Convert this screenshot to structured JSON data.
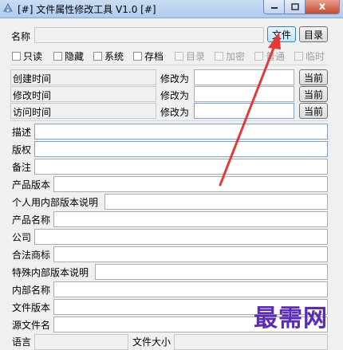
{
  "window": {
    "title": "[#] 文件属性修改工具 V1.0 [#]",
    "min_icon": "minimize-icon",
    "max_icon": "maximize-icon",
    "close_icon": "close-icon",
    "close_glyph": "x"
  },
  "name_row": {
    "label": "名称",
    "value": "",
    "file_button": "文件",
    "dir_button": "目录"
  },
  "attributes": [
    {
      "label": "只读",
      "checked": false,
      "enabled": true
    },
    {
      "label": "隐藏",
      "checked": false,
      "enabled": true
    },
    {
      "label": "系统",
      "checked": false,
      "enabled": true
    },
    {
      "label": "存档",
      "checked": false,
      "enabled": true
    },
    {
      "label": "目录",
      "checked": false,
      "enabled": false
    },
    {
      "label": "加密",
      "checked": false,
      "enabled": false
    },
    {
      "label": "普通",
      "checked": false,
      "enabled": false
    },
    {
      "label": "临时",
      "checked": false,
      "enabled": false
    }
  ],
  "times": [
    {
      "label": "创建时间",
      "modify_label": "修改为",
      "now_button": "当前"
    },
    {
      "label": "修改时间",
      "modify_label": "修改为",
      "now_button": "当前"
    },
    {
      "label": "访问时间",
      "modify_label": "修改为",
      "now_button": "当前"
    }
  ],
  "fields": [
    {
      "label": "描述"
    },
    {
      "label": "版权"
    },
    {
      "label": "备注"
    },
    {
      "label": "产品版本"
    },
    {
      "label": "个人用内部版本说明"
    },
    {
      "label": "产品名称"
    },
    {
      "label": "公司"
    },
    {
      "label": "合法商标"
    },
    {
      "label": "特殊内部版本说明"
    },
    {
      "label": "内部名称"
    },
    {
      "label": "文件版本"
    },
    {
      "label": "源文件名"
    }
  ],
  "bottom_row": {
    "language_label": "语言",
    "size_label": "文件大小"
  },
  "watermark": "最需网",
  "colors": {
    "annotation_arrow": "#e53935",
    "watermark": "#5b2bb5"
  }
}
